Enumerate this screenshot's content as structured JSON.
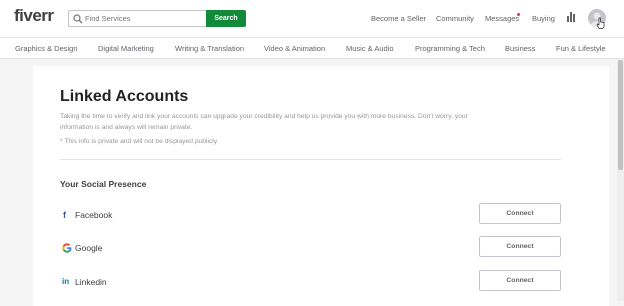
{
  "header": {
    "logo": "fiverr",
    "search_placeholder": "Find Services",
    "search_button": "Search",
    "links": {
      "become_seller": "Become a Seller",
      "community": "Community",
      "messages": "Messages",
      "buying": "Buying"
    }
  },
  "categories": [
    "Graphics & Design",
    "Digital Marketing",
    "Writing & Translation",
    "Video & Animation",
    "Music & Audio",
    "Programming & Tech",
    "Business",
    "Fun & Lifestyle"
  ],
  "main": {
    "title": "Linked Accounts",
    "description": "Taking the time to verify and link your accounts can upgrade your credibility and help us provide you with more business. Don't worry, your information is and always will remain private.",
    "note": "* This info is private and will not be displayed publicly.",
    "section_title": "Your Social Presence",
    "accounts": [
      {
        "name": "Facebook",
        "button": "Connect",
        "icon": "facebook-icon"
      },
      {
        "name": "Google",
        "button": "Connect",
        "icon": "google-icon"
      },
      {
        "name": "Linkedin",
        "button": "Connect",
        "icon": "linkedin-icon"
      }
    ]
  },
  "colors": {
    "brand_green": "#118a39",
    "facebook": "#3b5998",
    "linkedin": "#0077b5",
    "notification": "#e5334a"
  }
}
